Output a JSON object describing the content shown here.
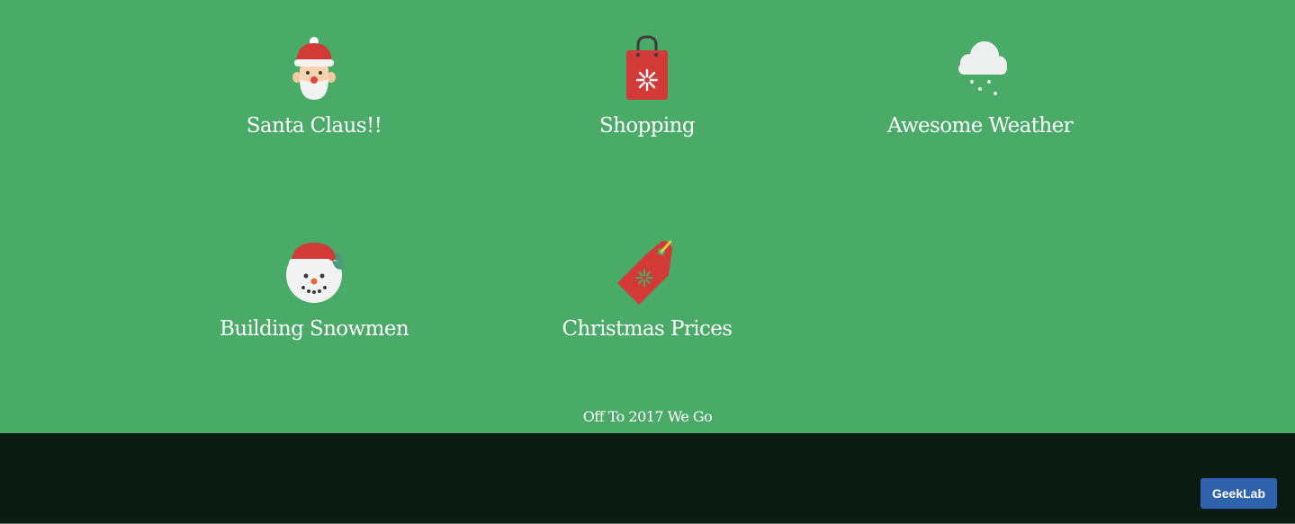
{
  "features": [
    {
      "label": "Santa Claus!!",
      "icon": "santa-icon"
    },
    {
      "label": "Shopping",
      "icon": "shopping-bag-icon"
    },
    {
      "label": "Awesome Weather",
      "icon": "snow-cloud-icon"
    },
    {
      "label": "Building Snowmen",
      "icon": "snowman-icon"
    },
    {
      "label": "Christmas Prices",
      "icon": "price-tag-icon"
    }
  ],
  "tagline": "Off To 2017 We Go",
  "footer": {
    "button_label": "GeekLab"
  },
  "colors": {
    "hero_background": "#4aaa67",
    "footer_background": "#0b1a12",
    "button_background": "#2e62ad",
    "icon_red": "#d13a36"
  }
}
